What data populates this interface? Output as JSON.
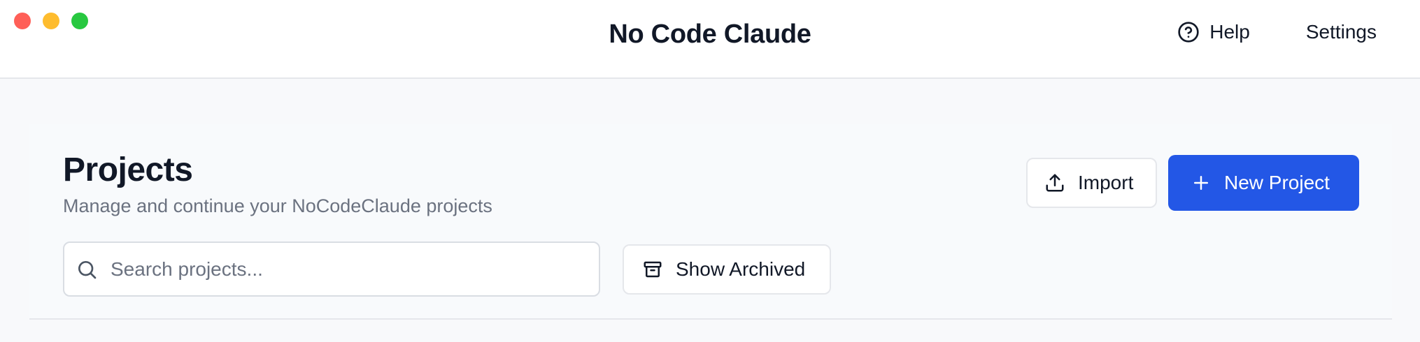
{
  "window": {
    "title": "No Code Claude",
    "controls": [
      "close",
      "minimize",
      "maximize"
    ]
  },
  "header": {
    "help_label": "Help",
    "help_icon": "question-circle-icon",
    "settings_label": "Settings"
  },
  "main": {
    "title": "Projects",
    "subtitle": "Manage and continue your NoCodeClaude projects",
    "import_label": "Import",
    "import_icon": "upload-icon",
    "new_project_label": "New Project",
    "new_project_icon": "plus-icon",
    "search": {
      "placeholder": "Search projects...",
      "value": "",
      "icon": "search-icon"
    },
    "show_archived_label": "Show Archived",
    "show_archived_icon": "archive-icon"
  },
  "colors": {
    "accent": "#2357e6",
    "close": "#ff5f57",
    "minimize": "#febc2e",
    "maximize": "#28c840"
  }
}
